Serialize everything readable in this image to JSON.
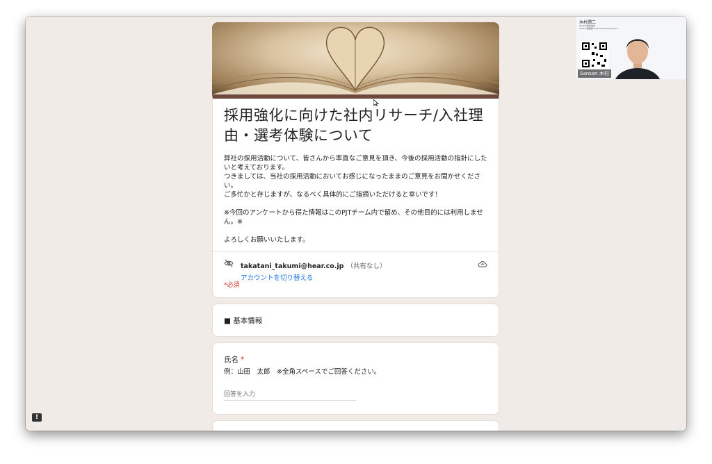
{
  "form": {
    "title": "採用強化に向けた社内リサーチ/入社理由・選考体験について",
    "description": "弊社の採用活動について、皆さんから率直なご意見を頂き、今後の採用活動の指針にしたいと考えております。\nつきましては、当社の採用活動においてお感じになったままのご意見をお聞かせください。\nご多忙かと存じますが、なるべく具体的にご指摘いただけると幸いです！\n\n※今回のアンケートから得た情報はこのPJTチーム内で留め、その他目的には利用しません。※\n\nよろしくお願いいたします。",
    "account_email": "takatani_takumi@hear.co.jp",
    "account_shared": "（共有なし）",
    "switch_account": "アカウントを切り替える",
    "required_note": "*必須"
  },
  "sections": {
    "basic_info": "■ 基本情報"
  },
  "question1": {
    "title": "氏名",
    "required_mark": "*",
    "hint": "例：山田　太郎　※全角スペースでご回答ください。",
    "placeholder": "回答を入力"
  },
  "video": {
    "participant_name": "木村潤二",
    "company_line": "Sansan株式会社",
    "role_line": "Sansan事業部 Business Development",
    "label": "Sansan 木村"
  },
  "feedback": {
    "icon": "!"
  },
  "colors": {
    "theme_header": "#6e4a3e",
    "link": "#1a73e8",
    "required": "#d93025",
    "background": "#f1ebe8"
  }
}
